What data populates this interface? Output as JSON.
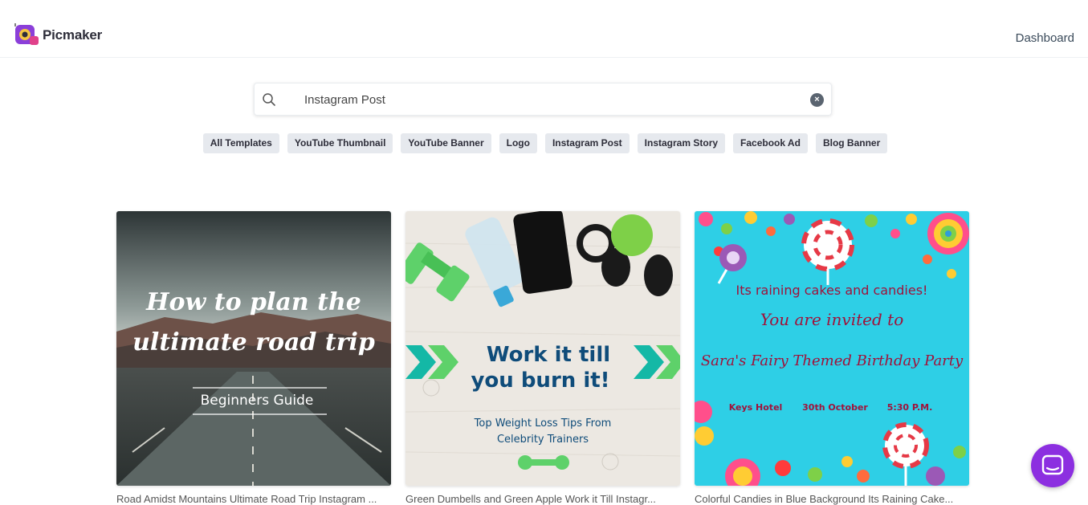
{
  "header": {
    "brand": "Picmaker",
    "dashboard_label": "Dashboard"
  },
  "search": {
    "value": "Instagram Post",
    "clear_icon": "close-circle-icon"
  },
  "categories": [
    "All Templates",
    "YouTube Thumbnail",
    "YouTube Banner",
    "Logo",
    "Instagram Post",
    "Instagram Story",
    "Facebook Ad",
    "Blog Banner"
  ],
  "templates": [
    {
      "line1": "How to plan the",
      "line2": "ultimate road trip",
      "subtitle": "Beginners Guide",
      "caption": "Road Amidst Mountains Ultimate Road Trip Instagram ..."
    },
    {
      "line1": "Work it till",
      "line2": "you burn it!",
      "sub1": "Top Weight Loss Tips From",
      "sub2": "Celebrity Trainers",
      "caption": "Green Dumbells and Green Apple Work it Till Instagr..."
    },
    {
      "line1": "Its raining cakes and candies!",
      "line2": "You are invited to",
      "line3": "Sara's Fairy Themed Birthday Party",
      "venue": "Keys Hotel",
      "date": "30th October",
      "time": "5:30 P.M.",
      "caption": "Colorful Candies in Blue Background Its Raining Cake..."
    }
  ],
  "colors": {
    "accent_purple": "#8c2fe0",
    "chip_bg": "#e6e9ee",
    "candy_bg": "#2ecfe6",
    "workout_teal": "#0f4c7a"
  }
}
